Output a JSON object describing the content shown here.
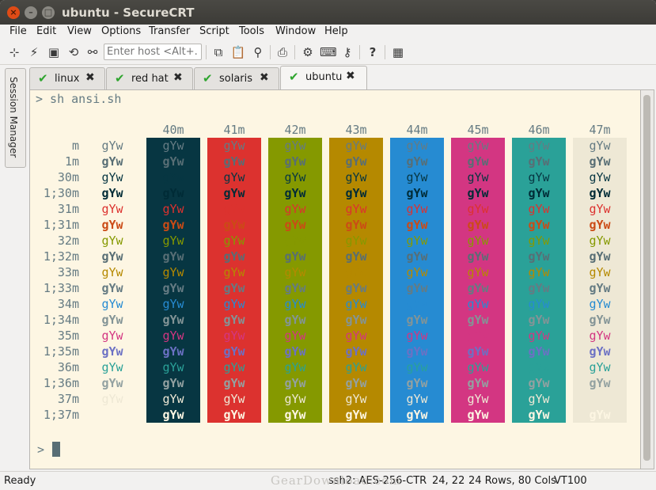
{
  "window": {
    "title": "ubuntu - SecureCRT"
  },
  "menu": [
    "File",
    "Edit",
    "View",
    "Options",
    "Transfer",
    "Script",
    "Tools",
    "Window",
    "Help"
  ],
  "toolbar": {
    "host_placeholder": "Enter host <Alt+...",
    "icons": [
      "connect-icon",
      "lightning-icon",
      "terminal-icon",
      "reconnect-icon",
      "disconnect-icon",
      "copy-icon",
      "paste-icon",
      "find-icon",
      "print-icon",
      "settings-icon",
      "keymap-icon",
      "sftp-icon",
      "help-icon",
      "screenshot-icon"
    ]
  },
  "side_panel": {
    "label": "Session Manager"
  },
  "tabs": [
    {
      "label": "linux",
      "status": "connected"
    },
    {
      "label": "red hat",
      "status": "connected"
    },
    {
      "label": "solaris",
      "status": "connected"
    },
    {
      "label": "ubuntu",
      "status": "connected",
      "active": true
    }
  ],
  "terminal": {
    "command_line": "> sh ansi.sh",
    "prompt": ">",
    "sample_text": "gYw",
    "bg_headers": [
      "40m",
      "41m",
      "42m",
      "43m",
      "44m",
      "45m",
      "46m",
      "47m"
    ],
    "bg_colors": [
      "#073642",
      "#dc322f",
      "#859900",
      "#b58900",
      "#268bd2",
      "#d33682",
      "#2aa198",
      "#eee8d5"
    ],
    "rows": [
      {
        "label": "m",
        "fg": "#657b83",
        "bold": false
      },
      {
        "label": "1m",
        "fg": "#586e75",
        "bold": true
      },
      {
        "label": "30m",
        "fg": "#073642",
        "bold": false
      },
      {
        "label": "1;30m",
        "fg": "#002b36",
        "bold": true
      },
      {
        "label": "31m",
        "fg": "#dc322f",
        "bold": false
      },
      {
        "label": "1;31m",
        "fg": "#cb4b16",
        "bold": true
      },
      {
        "label": "32m",
        "fg": "#859900",
        "bold": false
      },
      {
        "label": "1;32m",
        "fg": "#586e75",
        "bold": true
      },
      {
        "label": "33m",
        "fg": "#b58900",
        "bold": false
      },
      {
        "label": "1;33m",
        "fg": "#657b83",
        "bold": true
      },
      {
        "label": "34m",
        "fg": "#268bd2",
        "bold": false
      },
      {
        "label": "1;34m",
        "fg": "#839496",
        "bold": true
      },
      {
        "label": "35m",
        "fg": "#d33682",
        "bold": false
      },
      {
        "label": "1;35m",
        "fg": "#6c71c4",
        "bold": true
      },
      {
        "label": "36m",
        "fg": "#2aa198",
        "bold": false
      },
      {
        "label": "1;36m",
        "fg": "#93a1a1",
        "bold": true
      },
      {
        "label": "37m",
        "fg": "#eee8d5",
        "bold": false
      },
      {
        "label": "1;37m",
        "fg": "#fdf6e3",
        "bold": true
      }
    ]
  },
  "status": {
    "state": "Ready",
    "cipher": "ssh2: AES-256-CTR",
    "cursor_pos": "24, 22",
    "size": "24 Rows, 80 Cols",
    "emulation": "VT100"
  },
  "watermark": "GearDownload.com"
}
